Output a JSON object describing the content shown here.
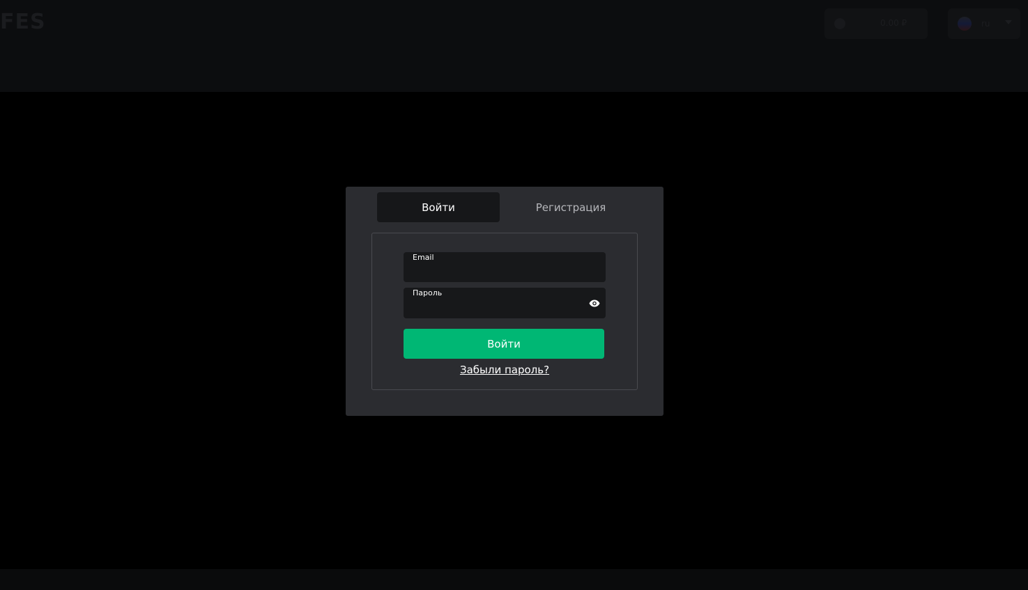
{
  "header": {
    "logo_text": "FES",
    "balance": {
      "value": "0.00 ₽",
      "icon": "coin-icon"
    },
    "language": {
      "code": "ru",
      "icon": "flag-icon"
    }
  },
  "auth_modal": {
    "tabs": [
      {
        "label": "Войти",
        "active": true
      },
      {
        "label": "Регистрация",
        "active": false
      }
    ],
    "email_field": {
      "label": "Email",
      "value": ""
    },
    "password_field": {
      "label": "Пароль",
      "value": "",
      "toggle_icon": "eye-icon"
    },
    "submit_label": "Войти",
    "forgot_link": "Забыли пароль?"
  },
  "colors": {
    "accent_green": "#00b774",
    "modal_bg": "#2b2c30",
    "field_bg": "#17181a",
    "page_bg": "#000000"
  }
}
